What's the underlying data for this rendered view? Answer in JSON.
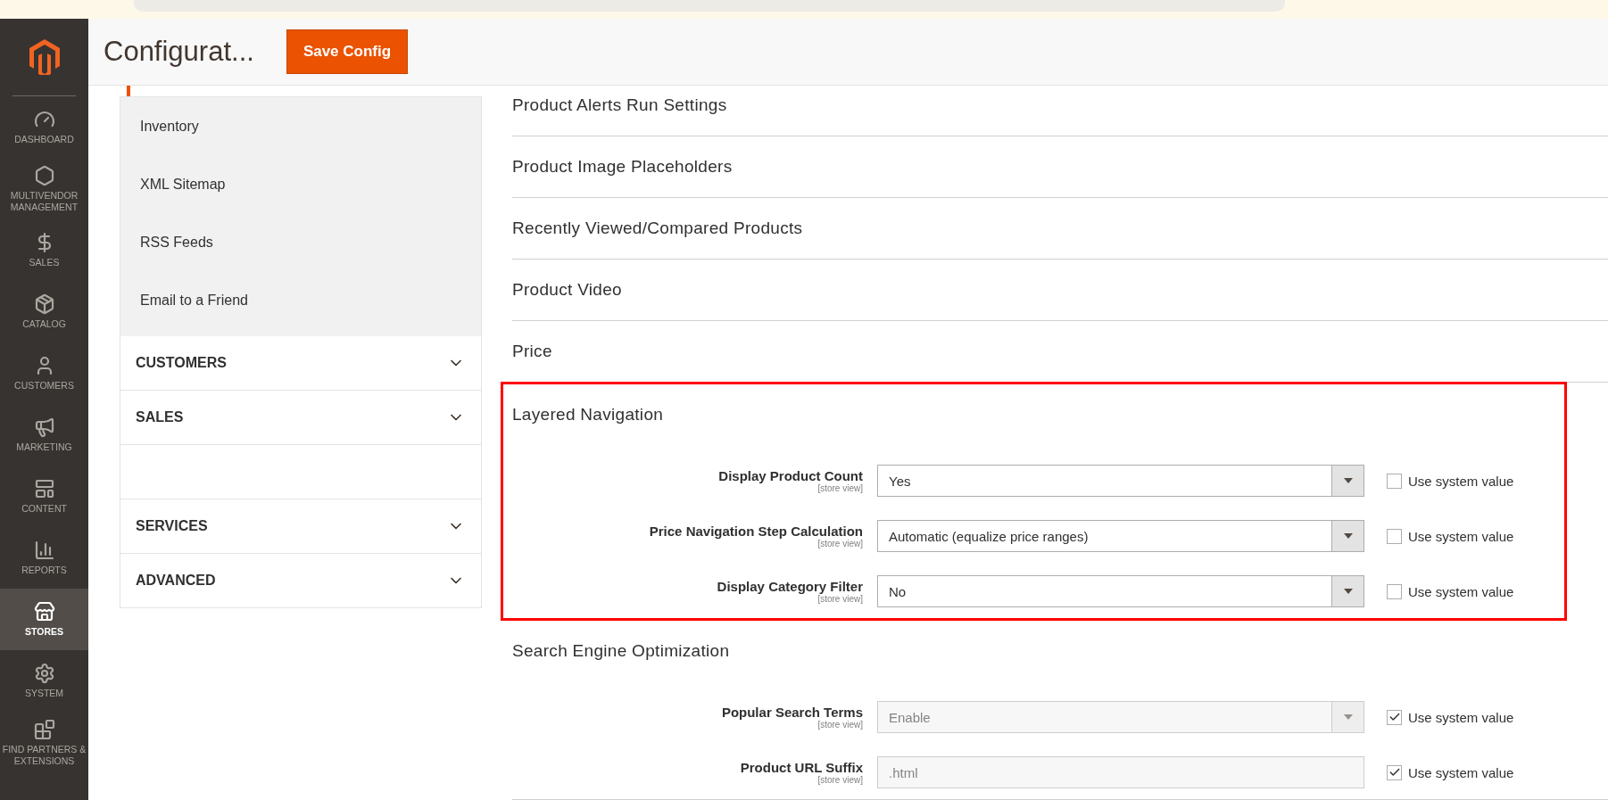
{
  "header": {
    "title": "Configurat...",
    "save_button": "Save Config"
  },
  "sidebar": {
    "items": [
      {
        "label": "DASHBOARD",
        "selected": false
      },
      {
        "label": "MULTIVENDOR MANAGEMENT",
        "selected": false
      },
      {
        "label": "SALES",
        "selected": false
      },
      {
        "label": "CATALOG",
        "selected": false
      },
      {
        "label": "CUSTOMERS",
        "selected": false
      },
      {
        "label": "MARKETING",
        "selected": false
      },
      {
        "label": "CONTENT",
        "selected": false
      },
      {
        "label": "REPORTS",
        "selected": false
      },
      {
        "label": "STORES",
        "selected": true
      },
      {
        "label": "SYSTEM",
        "selected": false
      },
      {
        "label": "FIND PARTNERS & EXTENSIONS",
        "selected": false
      }
    ]
  },
  "config_nav": {
    "items": [
      {
        "label": "Inventory"
      },
      {
        "label": "XML Sitemap"
      },
      {
        "label": "RSS Feeds"
      },
      {
        "label": "Email to a Friend"
      }
    ],
    "sections": [
      {
        "kind": "section",
        "label": "CUSTOMERS",
        "expanded": false
      },
      {
        "kind": "section",
        "label": "SALES",
        "expanded": false
      },
      {
        "kind": "redacted"
      },
      {
        "kind": "section",
        "label": "SERVICES",
        "expanded": false
      },
      {
        "kind": "section",
        "label": "ADVANCED",
        "expanded": false
      }
    ]
  },
  "groups": [
    {
      "title": "Product Alerts Run Settings",
      "highlighted": false
    },
    {
      "title": "Product Image Placeholders",
      "highlighted": false
    },
    {
      "title": "Recently Viewed/Compared Products",
      "highlighted": false
    },
    {
      "title": "Product Video",
      "highlighted": false
    },
    {
      "title": "Price",
      "highlighted": false
    },
    {
      "title": "Layered Navigation",
      "highlighted": true,
      "fields": [
        {
          "kind": "select",
          "label": "Display Product Count",
          "scope": "[store view]",
          "value": "Yes",
          "disabled": false,
          "use_system": {
            "label": "Use system value",
            "checked": false
          }
        },
        {
          "kind": "select",
          "label": "Price Navigation Step Calculation",
          "scope": "[store view]",
          "value": "Automatic (equalize price ranges)",
          "disabled": false,
          "use_system": {
            "label": "Use system value",
            "checked": false
          }
        },
        {
          "kind": "select",
          "label": "Display Category Filter",
          "scope": "[store view]",
          "value": "No",
          "disabled": false,
          "use_system": {
            "label": "Use system value",
            "checked": false
          }
        }
      ]
    },
    {
      "title": "Search Engine Optimization",
      "highlighted": false,
      "fields": [
        {
          "kind": "select",
          "label": "Popular Search Terms",
          "scope": "[store view]",
          "value": "Enable",
          "disabled": true,
          "use_system": {
            "label": "Use system value",
            "checked": true
          }
        },
        {
          "kind": "text",
          "label": "Product URL Suffix",
          "scope": "[store view]",
          "value": ".html",
          "disabled": true,
          "use_system": {
            "label": "Use system value",
            "checked": true
          }
        }
      ]
    }
  ]
}
